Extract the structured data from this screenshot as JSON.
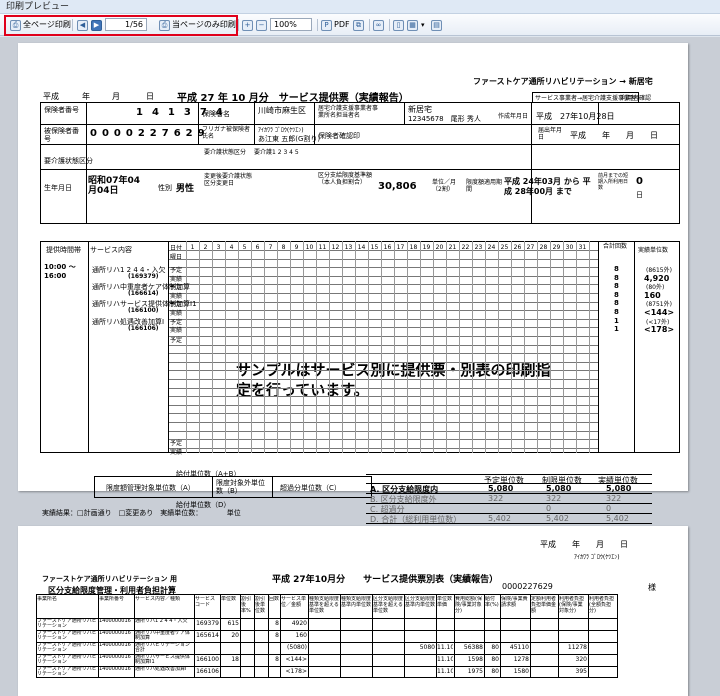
{
  "window": {
    "title": "印刷プレビュー"
  },
  "toolbar": {
    "print_all": "全ページ印刷",
    "page_indicator": "1/56",
    "print_current": "当ページのみ印刷",
    "zoom": "100%",
    "pdf": "PDF"
  },
  "page1": {
    "provider_line": "ファーストケア通所リハビリテーション → 新居宅",
    "provider_sub": "サービス事業者→居宅介護支援事業者",
    "heisei_label": "平成",
    "year_label": "年",
    "month_label": "月",
    "day_label": "日",
    "heading": "平成 27 年 10 月分　サービス提供票（実績報告）",
    "insured_no_label": "保険者番号",
    "insured_no_digits": [
      "1",
      "4",
      "1",
      "3",
      "7",
      "4"
    ],
    "insurer_name_label": "保険者名",
    "insurer_name": "川崎市麻生区",
    "care_plan_label": "居宅介護支援事業者事業所名担当者名",
    "care_plan_office": "新居宅",
    "care_plan_person": "12345678　尾形 秀人",
    "created_label": "作成年月日",
    "created_date": "平成　27年10月28日",
    "insured_person_label": "被保険者番号",
    "insured_person_digits": [
      "0",
      "0",
      "0",
      "0",
      "2",
      "2",
      "7",
      "6",
      "2",
      "9"
    ],
    "furigana_label": "フリガナ被保険者氏名",
    "furigana": "ｱｲｶﾜﾗ ｺﾞﾛｳ(ｹﾂｴﾝ)",
    "person_name": "あ江東 五郎(G割り)",
    "confirm_label": "保険者確認印",
    "notify_label": "届出年月日",
    "notify_date": "平成　　年　　月　　日",
    "dob_label": "生年月日",
    "dob": "昭和07年04月04日",
    "sex_label": "性別",
    "sex": "男性",
    "care_level_label": "要介護状態区分",
    "care_level_values": "要介護1 2 3 4 5",
    "change_label": "変更後要介護状態区分変更日",
    "limit_label": "区分支給限度基準額（本人負担割合）",
    "limit_value": "30,806",
    "limit_unit": "単位／月（2割）",
    "period_label": "限度額適用期間",
    "period_value": "平成 24年03月 から 平成 28年00月 まで",
    "prev_label": "前月までの短期入所利用日数",
    "prev_value": "0",
    "prev_unit": "日",
    "service_time_label": "提供時間帯",
    "service_content_label": "サービス内容",
    "date_label": "日付",
    "weekday_label": "曜日",
    "total_label": "合計回数",
    "units_label": "実績単位数",
    "time_range": "10:00 ～ 16:00",
    "services": [
      {
        "name": "通所リハ1 2 4 4・入欠",
        "code": "(169379)",
        "total": "8",
        "units": "(8615外)",
        "units2": "4,920"
      },
      {
        "name": "通所リハ中重度者ケア体制加算",
        "code": "(166614)",
        "total": "8",
        "units": "(80外)",
        "units2": "160"
      },
      {
        "name": "通所リハサービス提供体制加算Ⅰ1",
        "code": "(166100)",
        "total": "8",
        "units": "(8751外)",
        "units2": "<144>"
      },
      {
        "name": "通所リハ処遇改善加算Ⅰ",
        "code": "(166106)",
        "total": "1",
        "units": "(<17外)",
        "units2": "<178>"
      }
    ],
    "plan_label": "予定",
    "actual_label": "実績",
    "overlay_text": "サンプルはサービス別に提供票・別表の印刷指定を行っています。",
    "total_units_label": "給付単位数（A+B）",
    "limit_mgmt_label": "限度額管理対象単位数（A）",
    "limit_out_label": "限度対象外単位数（B）",
    "over_label": "超過分単位数（C）",
    "benefit_label": "給付単位数（D）",
    "result_note": "実績結果：□計画通り　□変更あり　実績単位数：　　　　単位",
    "sum_headers": [
      "予定単位数",
      "制限単位数",
      "実績単位数"
    ],
    "sum_rows": [
      {
        "label": "A. 区分支給限度内",
        "v1": "5,080",
        "v2": "5,080",
        "v3": "5,080"
      },
      {
        "label": "B. 区分支給限度外",
        "v1": "322",
        "v2": "322",
        "v3": "322"
      },
      {
        "label": "C. 超過分",
        "v1": "",
        "v2": "0",
        "v3": "0"
      },
      {
        "label": "D. 合計（総利用単位数）",
        "v1": "5,402",
        "v2": "5,402",
        "v3": "5,402"
      }
    ]
  },
  "page2": {
    "date_line": "平成　　年　　月　　日",
    "furigana": "ｱｲｶﾜﾗ ｺﾞﾛｳ(ｹﾂｴﾝ)",
    "provider": "ファーストケア通所リハビリテーション 用",
    "heading": "平成 27年10月分　　サービス提供票別表（実績報告）",
    "insured_no": "0000227629",
    "sama": "様",
    "sub_heading": "区分支給限度管理・利用者負担計算",
    "columns": [
      "事業所名",
      "事業所番号",
      "サービス内容／種類",
      "サービスコード",
      "単位数",
      "割引後率%",
      "割引後単位数",
      "回数",
      "サービス単位／金額",
      "種類支給限度基準を超える単位数",
      "種類支給限度基準内単位数",
      "区分支給限度基準を超える単位数",
      "区分支給限度基準内単位数",
      "単位数単価",
      "費用総額(保険/事業対象分)",
      "給付率(%)",
      "保険/事業費請求額",
      "定額利用者負担単価金額",
      "利用者負担(保険/事業対象分)",
      "利用者負担(全額負担分)"
    ],
    "rows": [
      [
        "ファーストケア通所リハビリテーション",
        "1400000016",
        "通所リハ1 2 4 4・入欠",
        "169379",
        "615",
        "",
        "",
        "8",
        "4920",
        "",
        "",
        "",
        "",
        "",
        "",
        "",
        "",
        "",
        "",
        ""
      ],
      [
        "ファーストケア通所リハビリテーション",
        "1400000016",
        "通所リハ中重度者ケア体制加算",
        "165614",
        "20",
        "",
        "",
        "8",
        "160",
        "",
        "",
        "",
        "",
        "",
        "",
        "",
        "",
        "",
        "",
        ""
      ],
      [
        "ファーストケア通所リハビリテーション",
        "1400000016",
        "通所リハビリテーション合計",
        "",
        "",
        "",
        "",
        "",
        "(5080)",
        "",
        "",
        "",
        "5080",
        "11.10",
        "56388",
        "80",
        "45110",
        "",
        "11278",
        ""
      ],
      [
        "ファーストケア通所リハビリテーション",
        "1400000016",
        "通所リハサービス提供体制加算Ⅰ1",
        "166100",
        "18",
        "",
        "",
        "8",
        "<144>",
        "",
        "",
        "",
        "",
        "11.10",
        "1598",
        "80",
        "1278",
        "",
        "320",
        ""
      ],
      [
        "ファーストケア通所リハビリテーション",
        "1400000016",
        "通所リハ処遇改善加算Ⅰ",
        "166106",
        "",
        "",
        "",
        "",
        "<178>",
        "",
        "",
        "",
        "",
        "11.10",
        "1975",
        "80",
        "1580",
        "",
        "395",
        ""
      ]
    ]
  }
}
